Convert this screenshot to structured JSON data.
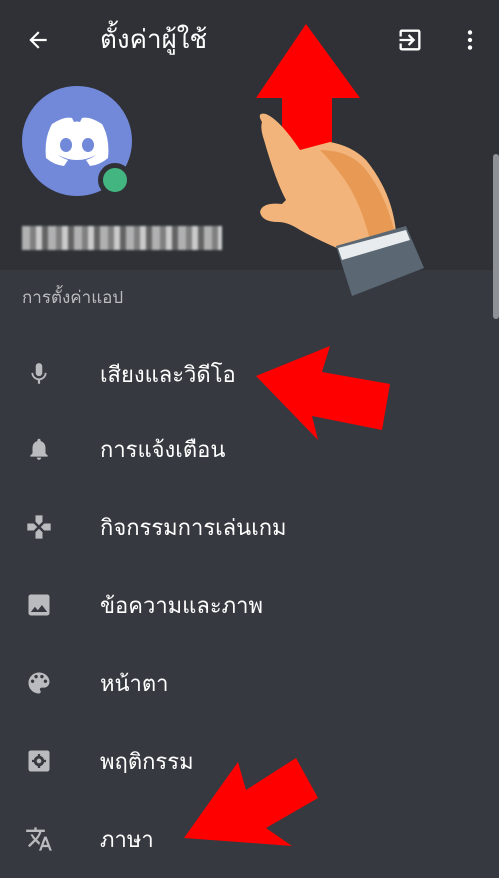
{
  "appbar": {
    "title": "ตั้งค่าผู้ใช้",
    "back_icon": "arrow-back-icon",
    "logout_icon": "logout-icon",
    "more_icon": "more-vertical-icon"
  },
  "profile": {
    "avatar_icon": "discord-logo-icon",
    "status_color": "#43b581",
    "avatar_color": "#7289da"
  },
  "section": {
    "label": "การตั้งค่าแอป"
  },
  "settings_items": [
    {
      "label": "เสียงและวิดีโอ",
      "icon": "microphone-icon"
    },
    {
      "label": "การแจ้งเตือน",
      "icon": "bell-icon"
    },
    {
      "label": "กิจกรรมการเล่นเกม",
      "icon": "gamepad-icon"
    },
    {
      "label": "ข้อความและภาพ",
      "icon": "image-icon"
    },
    {
      "label": "หน้าตา",
      "icon": "palette-icon"
    },
    {
      "label": "พฤติกรรม",
      "icon": "settings-box-icon"
    },
    {
      "label": "ภาษา",
      "icon": "translate-icon"
    }
  ],
  "colors": {
    "background": "#36393f",
    "header": "#2f3136",
    "annotation_arrow": "#ff0000"
  }
}
